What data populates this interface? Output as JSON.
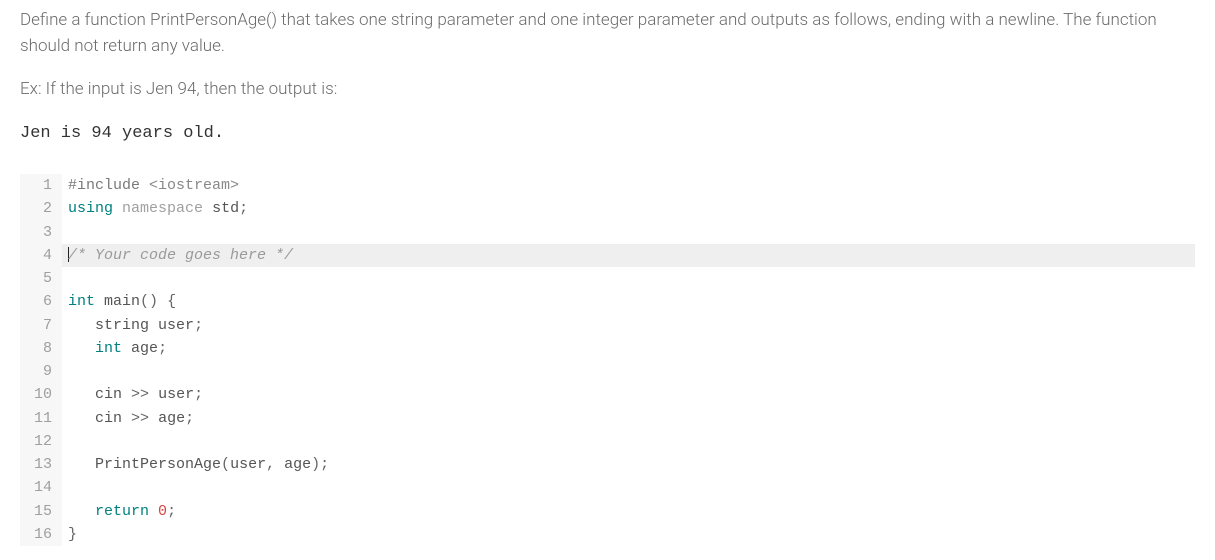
{
  "question": {
    "paragraph": "Define a function PrintPersonAge() that takes one string parameter and one integer parameter and outputs as follows, ending with a newline. The function should not return any value.",
    "example_label": "Ex: If the input is Jen 94, then the output is:",
    "example_output": "Jen is 94 years old."
  },
  "code": {
    "language": "cpp",
    "active_line": 4,
    "lines": [
      {
        "n": 1,
        "tokens": [
          {
            "t": "#include",
            "c": "tok-preproc"
          },
          {
            "t": " ",
            "c": ""
          },
          {
            "t": "<iostream>",
            "c": "tok-angle"
          }
        ]
      },
      {
        "n": 2,
        "tokens": [
          {
            "t": "using",
            "c": "tok-keyword"
          },
          {
            "t": " ",
            "c": ""
          },
          {
            "t": "namespace",
            "c": "tok-namespace"
          },
          {
            "t": " ",
            "c": ""
          },
          {
            "t": "std",
            "c": "tok-ident"
          },
          {
            "t": ";",
            "c": "tok-punct"
          }
        ]
      },
      {
        "n": 3,
        "tokens": []
      },
      {
        "n": 4,
        "tokens": [
          {
            "t": "/* Your code goes here */",
            "c": "tok-comment"
          }
        ]
      },
      {
        "n": 5,
        "tokens": []
      },
      {
        "n": 6,
        "tokens": [
          {
            "t": "int",
            "c": "tok-type"
          },
          {
            "t": " ",
            "c": ""
          },
          {
            "t": "main",
            "c": "tok-ident"
          },
          {
            "t": "()",
            "c": "tok-punct"
          },
          {
            "t": " ",
            "c": ""
          },
          {
            "t": "{",
            "c": "tok-punct"
          }
        ]
      },
      {
        "n": 7,
        "tokens": [
          {
            "t": "   ",
            "c": ""
          },
          {
            "t": "string",
            "c": "tok-ident"
          },
          {
            "t": " ",
            "c": ""
          },
          {
            "t": "user",
            "c": "tok-ident"
          },
          {
            "t": ";",
            "c": "tok-punct"
          }
        ]
      },
      {
        "n": 8,
        "tokens": [
          {
            "t": "   ",
            "c": ""
          },
          {
            "t": "int",
            "c": "tok-type"
          },
          {
            "t": " ",
            "c": ""
          },
          {
            "t": "age",
            "c": "tok-ident"
          },
          {
            "t": ";",
            "c": "tok-punct"
          }
        ]
      },
      {
        "n": 9,
        "tokens": []
      },
      {
        "n": 10,
        "tokens": [
          {
            "t": "   ",
            "c": ""
          },
          {
            "t": "cin",
            "c": "tok-ident"
          },
          {
            "t": " ",
            "c": ""
          },
          {
            "t": ">>",
            "c": "tok-punct"
          },
          {
            "t": " ",
            "c": ""
          },
          {
            "t": "user",
            "c": "tok-ident"
          },
          {
            "t": ";",
            "c": "tok-punct"
          }
        ]
      },
      {
        "n": 11,
        "tokens": [
          {
            "t": "   ",
            "c": ""
          },
          {
            "t": "cin",
            "c": "tok-ident"
          },
          {
            "t": " ",
            "c": ""
          },
          {
            "t": ">>",
            "c": "tok-punct"
          },
          {
            "t": " ",
            "c": ""
          },
          {
            "t": "age",
            "c": "tok-ident"
          },
          {
            "t": ";",
            "c": "tok-punct"
          }
        ]
      },
      {
        "n": 12,
        "tokens": []
      },
      {
        "n": 13,
        "tokens": [
          {
            "t": "   ",
            "c": ""
          },
          {
            "t": "PrintPersonAge",
            "c": "tok-ident"
          },
          {
            "t": "(",
            "c": "tok-punct"
          },
          {
            "t": "user",
            "c": "tok-ident"
          },
          {
            "t": ",",
            "c": "tok-punct"
          },
          {
            "t": " ",
            "c": ""
          },
          {
            "t": "age",
            "c": "tok-ident"
          },
          {
            "t": ")",
            "c": "tok-punct"
          },
          {
            "t": ";",
            "c": "tok-punct"
          }
        ]
      },
      {
        "n": 14,
        "tokens": []
      },
      {
        "n": 15,
        "tokens": [
          {
            "t": "   ",
            "c": ""
          },
          {
            "t": "return",
            "c": "tok-keyword"
          },
          {
            "t": " ",
            "c": ""
          },
          {
            "t": "0",
            "c": "tok-number"
          },
          {
            "t": ";",
            "c": "tok-punct"
          }
        ]
      },
      {
        "n": 16,
        "tokens": [
          {
            "t": "}",
            "c": "tok-punct"
          }
        ]
      }
    ]
  }
}
